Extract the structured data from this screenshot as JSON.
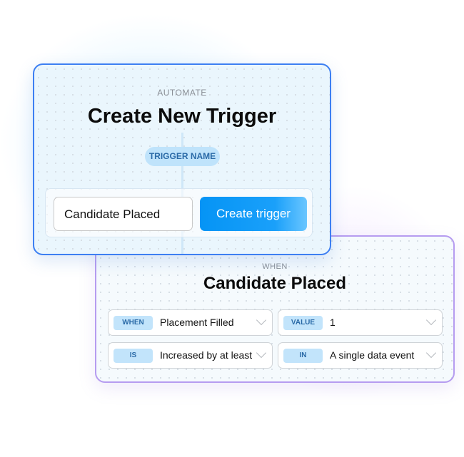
{
  "trigger_card": {
    "eyebrow": "AUTOMATE",
    "title": "Create New Trigger",
    "name_label": "TRIGGER NAME",
    "name_value": "Candidate Placed",
    "create_button": "Create trigger"
  },
  "condition_card": {
    "eyebrow": "WHEN",
    "title": "Candidate Placed",
    "fields": [
      {
        "tag": "WHEN",
        "value": "Placement Filled"
      },
      {
        "tag": "VALUE",
        "value": "1"
      },
      {
        "tag": "IS",
        "value": "Increased by at least"
      },
      {
        "tag": "IN",
        "value": "A single data event"
      }
    ]
  },
  "colors": {
    "accent": "#0594f5",
    "card1_border": "#3d7ff2",
    "card2_border": "#b69cf0",
    "tag_bg": "#c2e4fb"
  }
}
